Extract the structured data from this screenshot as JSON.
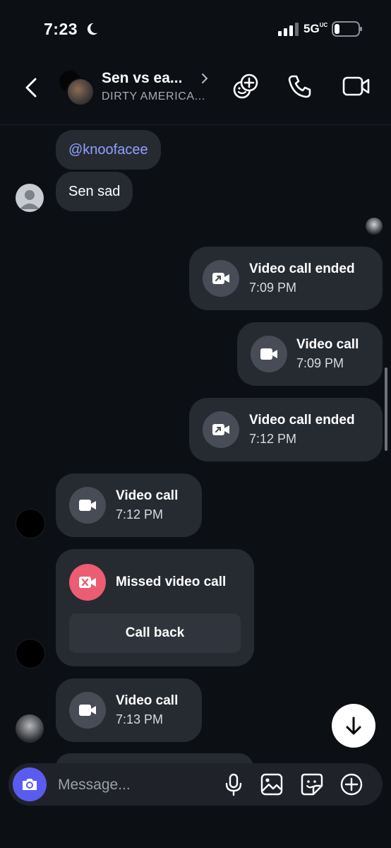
{
  "status_bar": {
    "time": "7:23",
    "network": "5G",
    "network_sub": "UC"
  },
  "header": {
    "title": "Sen vs ea...",
    "subtitle": "DIRTY AMERICA..."
  },
  "messages": {
    "mention": "@knoofacee",
    "text1": "Sen sad",
    "call1": {
      "title": "Video call ended",
      "time": "7:09 PM"
    },
    "call2": {
      "title": "Video call",
      "time": "7:09 PM"
    },
    "call3": {
      "title": "Video call ended",
      "time": "7:12 PM"
    },
    "call4": {
      "title": "Video call",
      "time": "7:12 PM"
    },
    "missed": {
      "title": "Missed video call",
      "button": "Call back"
    },
    "call5": {
      "title": "Video call",
      "time": "7:13 PM"
    }
  },
  "composer": {
    "placeholder": "Message..."
  },
  "colors": {
    "background": "#0c0f14",
    "bubble": "#262a31",
    "accent": "#5a5cf0",
    "mention": "#8ea2ff",
    "missed": "#ec5c72"
  },
  "icons": [
    "moon-icon",
    "signal-icon",
    "battery-icon",
    "back-icon",
    "chevron-right-icon",
    "add-people-icon",
    "phone-icon",
    "video-icon",
    "video-camera-icon",
    "outgoing-video-icon",
    "missed-video-icon",
    "arrow-down-icon",
    "camera-icon",
    "microphone-icon",
    "gallery-icon",
    "sticker-icon",
    "plus-icon"
  ]
}
